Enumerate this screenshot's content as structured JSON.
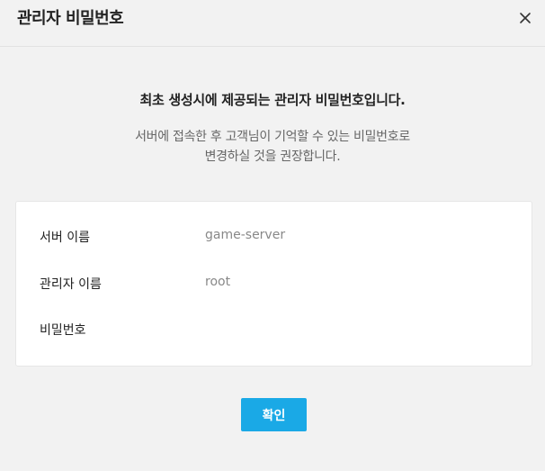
{
  "dialog": {
    "title": "관리자 비밀번호",
    "close_icon": "close-icon"
  },
  "notice": "최초 생성시에 제공되는 관리자 비밀번호입니다.",
  "description": [
    "서버에 접속한 후 고객님이 기억할 수 있는 비밀번호로",
    "변경하실 것을 권장합니다."
  ],
  "info": {
    "server_name": {
      "label": "서버 이름",
      "value": "game-server"
    },
    "admin_name": {
      "label": "관리자 이름",
      "value": "root"
    },
    "password": {
      "label": "비밀번호",
      "value": ""
    }
  },
  "confirm_label": "확인",
  "colors": {
    "accent": "#1aa9e6",
    "background": "#f2f2f2"
  }
}
